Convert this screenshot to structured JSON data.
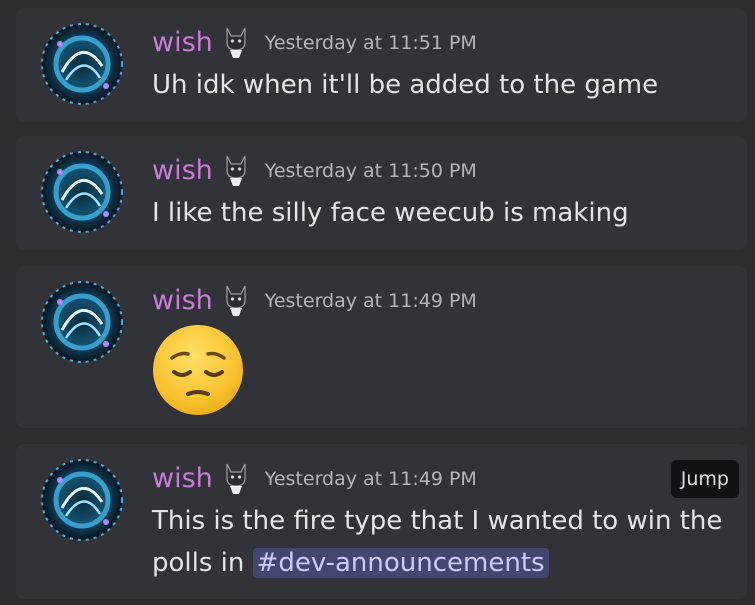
{
  "messages": [
    {
      "username": "wish",
      "timestamp": "Yesterday at 11:51 PM",
      "content": "Uh idk when it'll be added to the game"
    },
    {
      "username": "wish",
      "timestamp": "Yesterday at 11:50 PM",
      "content": "I like the silly face weecub is making"
    },
    {
      "username": "wish",
      "timestamp": "Yesterday at 11:49 PM",
      "emoji": "pensive-face-emoji"
    },
    {
      "username": "wish",
      "timestamp": "Yesterday at 11:49 PM",
      "content": "This is the fire type that I wanted to win the polls in",
      "mention": "#dev-announcements",
      "action": "Jump"
    }
  ],
  "colors": {
    "background": "#2b2d31",
    "card": "#313338",
    "username": "#c77dd6",
    "timestamp": "#b1b5bc",
    "text": "#e3e5e8",
    "mention_bg": "#43466f",
    "mention_text": "#c9cdfb"
  },
  "icons": {
    "avatar": "avatar-icon",
    "badge": "cat-badge-icon"
  }
}
